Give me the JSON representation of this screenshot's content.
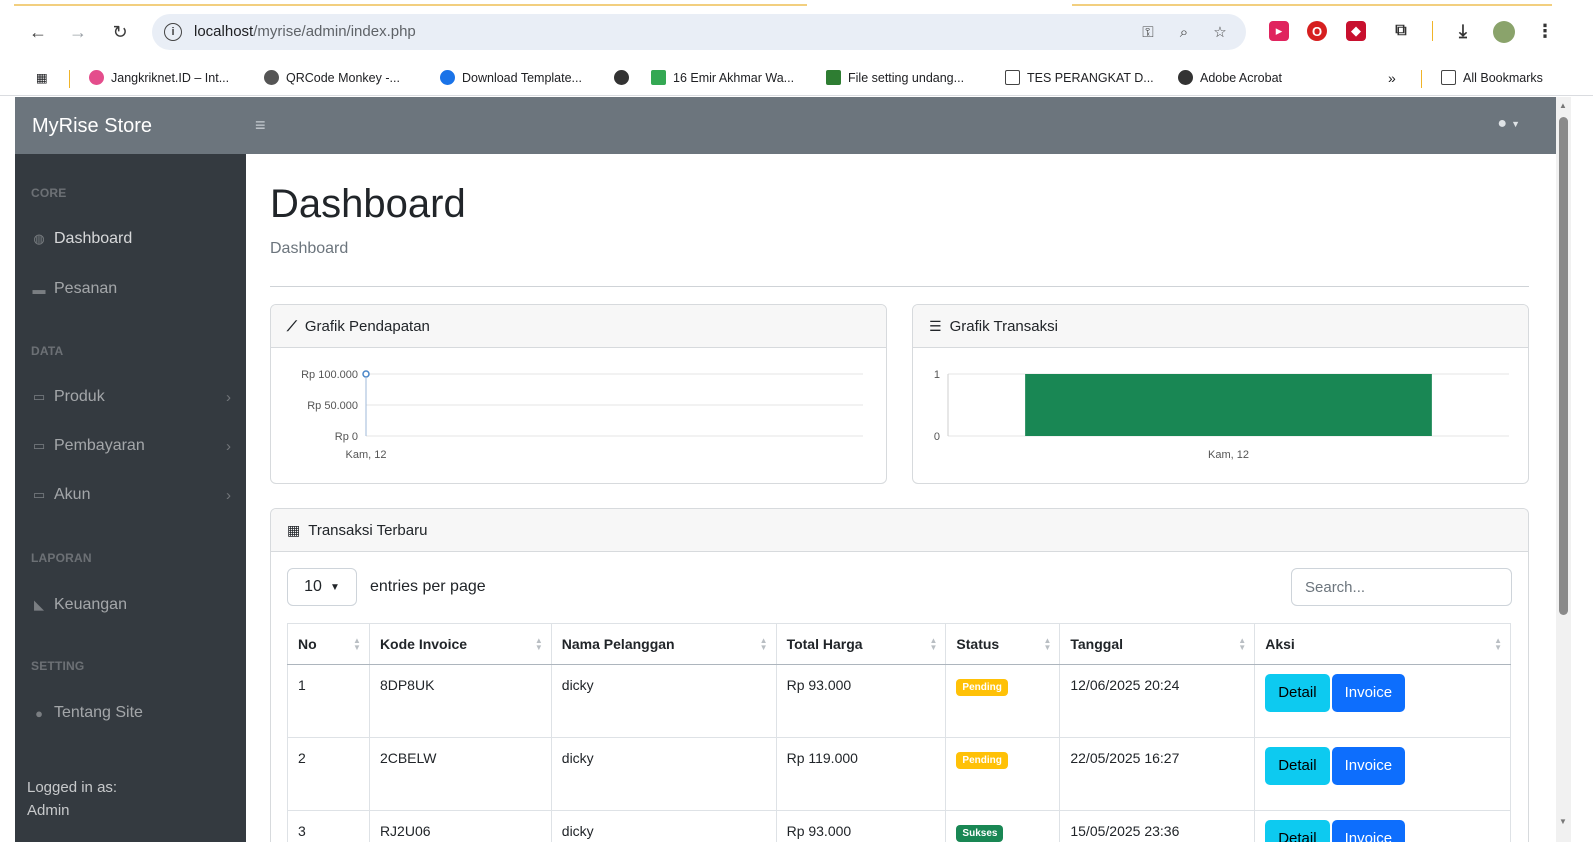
{
  "browser": {
    "url_host": "localhost",
    "url_path": "/myrise/admin/index.php",
    "bookmarks": [
      "Jangkriknet.ID – Int...",
      "QRCode Monkey -...",
      "Download Template...",
      "16 Emir Akhmar Wa...",
      "File setting undang...",
      "TES PERANGKAT D...",
      "Adobe Acrobat"
    ],
    "overflow_label": "»",
    "all_bookmarks": "All Bookmarks"
  },
  "app": {
    "brand": "MyRise Store",
    "toggle_glyph": "≡"
  },
  "sidebar": {
    "headings": [
      "CORE",
      "DATA",
      "LAPORAN",
      "SETTING"
    ],
    "items": [
      "Dashboard",
      "Pesanan",
      "Produk",
      "Pembayaran",
      "Akun",
      "Keuangan",
      "Tentang Site"
    ],
    "logged_in_label": "Logged in as:",
    "logged_in_user": "Admin"
  },
  "main": {
    "title": "Dashboard",
    "breadcrumb": "Dashboard",
    "revenue_card_title": "Grafik Pendapatan",
    "transaction_card_title": "Grafik Transaksi",
    "table_card_title": "Transaksi Terbaru",
    "entries_value": "10",
    "entries_label": "entries per page",
    "search_placeholder": "Search...",
    "columns": [
      "No",
      "Kode Invoice",
      "Nama Pelanggan",
      "Total Harga",
      "Status",
      "Tanggal",
      "Aksi"
    ],
    "rows": [
      {
        "no": "1",
        "kode": "8DP8UK",
        "nama": "dicky",
        "total": "Rp 93.000",
        "status": "Pending",
        "tanggal": "12/06/2025 20:24"
      },
      {
        "no": "2",
        "kode": "2CBELW",
        "nama": "dicky",
        "total": "Rp 119.000",
        "status": "Pending",
        "tanggal": "22/05/2025 16:27"
      },
      {
        "no": "3",
        "kode": "RJ2U06",
        "nama": "dicky",
        "total": "Rp 93.000",
        "status": "Sukses",
        "tanggal": "15/05/2025 23:36"
      }
    ],
    "detail_label": "Detail",
    "invoice_label": "Invoice"
  },
  "colors": {
    "pending": "#ffc107",
    "sukses": "#198754",
    "bar": "#198754",
    "line_point": "#4a86c8"
  },
  "chart_data": [
    {
      "type": "line",
      "title": "",
      "x": [
        "Kam, 12"
      ],
      "series": [
        {
          "values": [
            100000
          ]
        }
      ],
      "y_tick_labels": [
        "Rp 100.000",
        "Rp 50.000",
        "Rp 0"
      ],
      "ylim": [
        0,
        100000
      ],
      "grid": true
    },
    {
      "type": "bar",
      "title": "",
      "categories": [
        "Kam, 12"
      ],
      "series": [
        {
          "values": [
            1
          ]
        }
      ],
      "y_tick_labels": [
        "1",
        "0"
      ],
      "ylim": [
        0,
        1
      ],
      "grid": true
    }
  ]
}
